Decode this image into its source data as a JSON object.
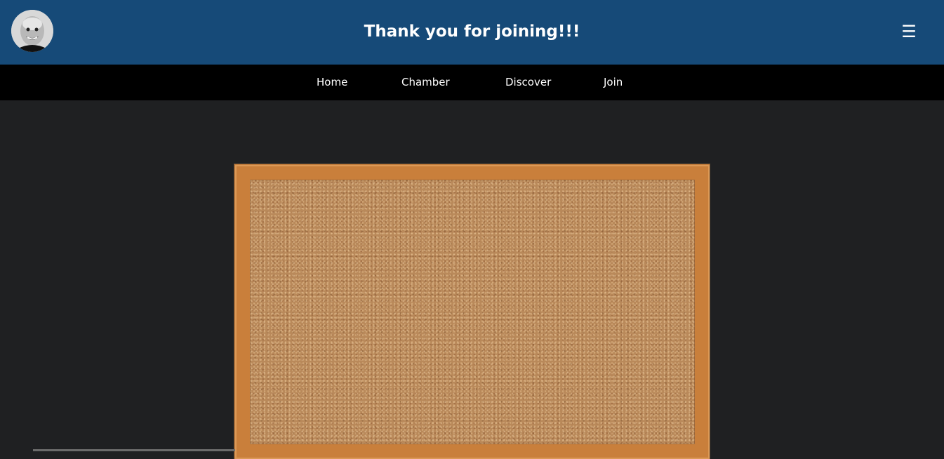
{
  "header": {
    "title": "Thank you for joining!!!",
    "menu_icon": "☰",
    "avatar_icon": "avatar-face-icon",
    "background": "#164a78"
  },
  "nav": {
    "items": [
      {
        "label": "Home"
      },
      {
        "label": "Chamber"
      },
      {
        "label": "Discover"
      },
      {
        "label": "Join"
      }
    ],
    "background": "#000000"
  },
  "main": {
    "background": "#1f2022",
    "image": "corkboard-image"
  }
}
